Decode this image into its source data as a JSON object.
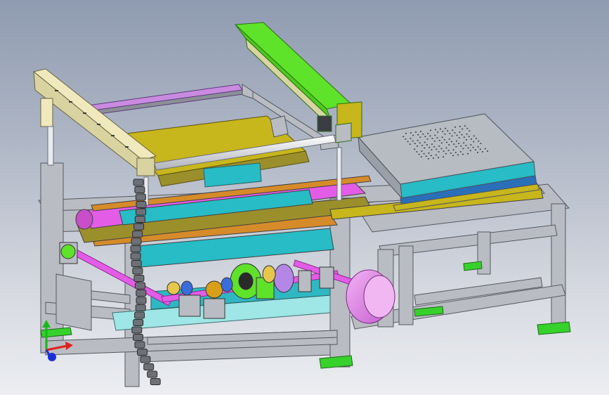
{
  "view": {
    "background_top": "#8f9bb0",
    "background_bottom": "#eceef2"
  },
  "triad": {
    "x_color": "#e0201c",
    "y_color": "#18b818",
    "z_color": "#1a2fd8"
  },
  "colors": {
    "frame": "#b9bcc2",
    "frame_edge": "#55585e",
    "gantry_beam": "#efe9bd",
    "green_beam": "#5fe22a",
    "yellow_plate": "#c7b61c",
    "cyan_part": "#27bcc6",
    "magenta_part": "#e35ce6",
    "violet_part": "#c98be0",
    "motor": "#e38ae8",
    "base_plate": "#9fe6e6",
    "vacuum_table": "#b7bbc2",
    "foot_pad": "#37d12c"
  }
}
